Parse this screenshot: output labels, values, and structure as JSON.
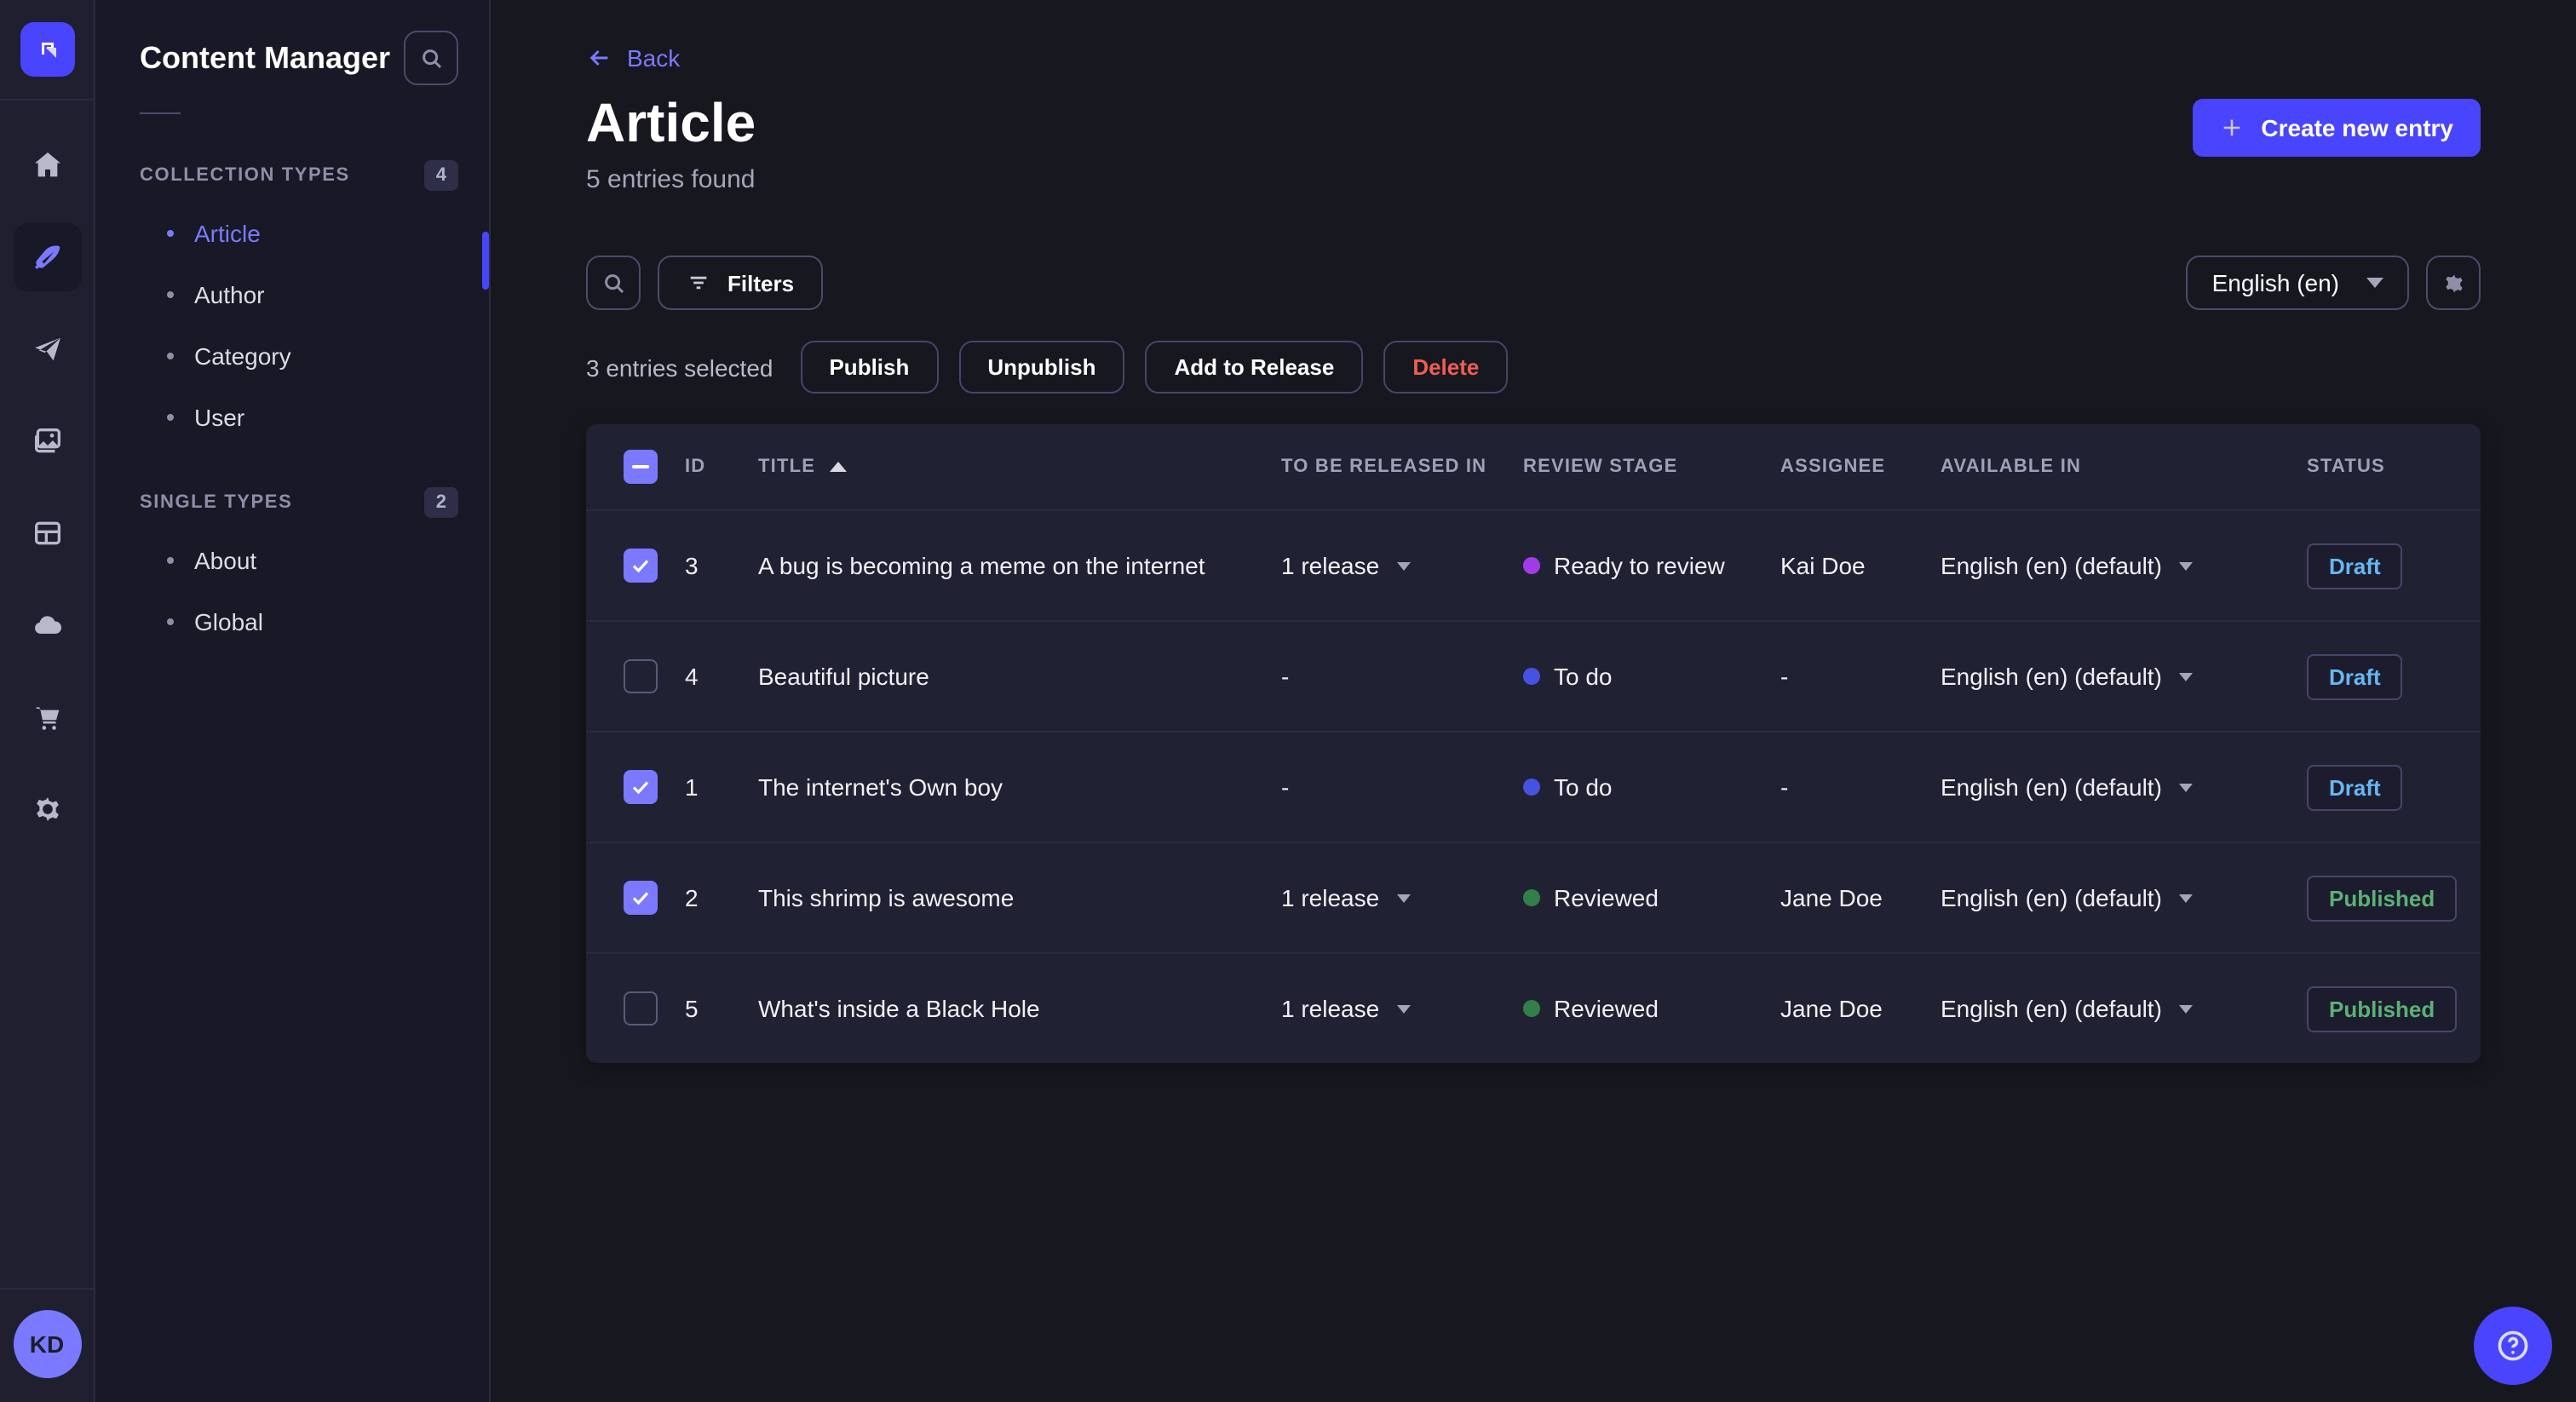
{
  "colors": {
    "accent": "#4945ff",
    "primary_light": "#7b79ff",
    "draft": "#66b7f1",
    "published": "#5cb176",
    "danger": "#ee5e52",
    "stage_todo": "#4553e0",
    "stage_ready": "#a13be8",
    "stage_reviewed": "#328048"
  },
  "rail": {
    "icons": [
      "strapi-logo",
      "home-icon",
      "feather-content-icon",
      "paper-plane-icon",
      "media-images-icon",
      "layout-builder-icon",
      "cloud-icon",
      "cart-icon",
      "gear-icon"
    ],
    "active_item": "content-manager",
    "avatar_initials": "KD"
  },
  "subnav": {
    "title": "Content Manager",
    "sections": [
      {
        "label": "COLLECTION TYPES",
        "count": "4",
        "items": [
          {
            "label": "Article",
            "active": true
          },
          {
            "label": "Author",
            "active": false
          },
          {
            "label": "Category",
            "active": false
          },
          {
            "label": "User",
            "active": false
          }
        ]
      },
      {
        "label": "SINGLE TYPES",
        "count": "2",
        "items": [
          {
            "label": "About",
            "active": false
          },
          {
            "label": "Global",
            "active": false
          }
        ]
      }
    ]
  },
  "header": {
    "back_label": "Back",
    "title": "Article",
    "subtitle": "5 entries found",
    "create_button": "Create new entry"
  },
  "toolbar": {
    "filters_label": "Filters",
    "locale_value": "English (en)"
  },
  "selection": {
    "text": "3 entries selected",
    "publish_label": "Publish",
    "unpublish_label": "Unpublish",
    "add_to_release_label": "Add to Release",
    "delete_label": "Delete"
  },
  "table": {
    "headers": {
      "id": "ID",
      "title": "TITLE",
      "released": "TO BE RELEASED IN",
      "review": "REVIEW STAGE",
      "assignee": "ASSIGNEE",
      "available": "AVAILABLE IN",
      "status": "STATUS"
    },
    "sort_column": "TITLE",
    "sort_direction": "ascending",
    "rows": [
      {
        "checked": true,
        "id": "3",
        "title": "A bug is becoming a meme on the internet",
        "released": "1 release",
        "review": {
          "label": "Ready to review",
          "color": "#a13be8"
        },
        "assignee": "Kai Doe",
        "available": "English (en) (default)",
        "status": {
          "label": "Draft",
          "color": "#66b7f1"
        }
      },
      {
        "checked": false,
        "id": "4",
        "title": "Beautiful picture",
        "released": "-",
        "review": {
          "label": "To do",
          "color": "#4553e0"
        },
        "assignee": "-",
        "available": "English (en) (default)",
        "status": {
          "label": "Draft",
          "color": "#66b7f1"
        }
      },
      {
        "checked": true,
        "id": "1",
        "title": "The internet's Own boy",
        "released": "-",
        "review": {
          "label": "To do",
          "color": "#4553e0"
        },
        "assignee": "-",
        "available": "English (en) (default)",
        "status": {
          "label": "Draft",
          "color": "#66b7f1"
        }
      },
      {
        "checked": true,
        "id": "2",
        "title": "This shrimp is awesome",
        "released": "1 release",
        "review": {
          "label": "Reviewed",
          "color": "#328048"
        },
        "assignee": "Jane Doe",
        "available": "English (en) (default)",
        "status": {
          "label": "Published",
          "color": "#5cb176"
        }
      },
      {
        "checked": false,
        "id": "5",
        "title": "What's inside a Black Hole",
        "released": "1 release",
        "review": {
          "label": "Reviewed",
          "color": "#328048"
        },
        "assignee": "Jane Doe",
        "available": "English (en) (default)",
        "status": {
          "label": "Published",
          "color": "#5cb176"
        }
      }
    ]
  },
  "help": {
    "tooltip": "help"
  }
}
